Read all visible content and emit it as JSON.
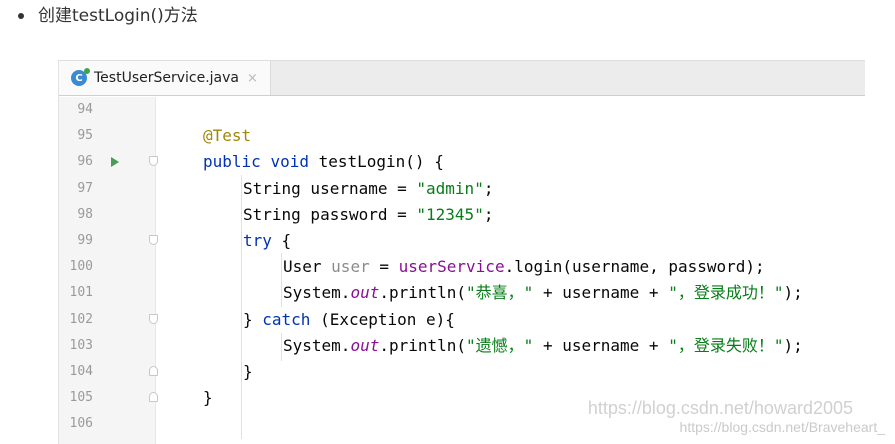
{
  "bullet": {
    "text": "创建testLogin()方法"
  },
  "tab": {
    "icon": "java-class-icon",
    "icon_letter": "C",
    "title": "TestUserService.java",
    "close": "×"
  },
  "lines": [
    {
      "n": "94"
    },
    {
      "n": "95"
    },
    {
      "n": "96"
    },
    {
      "n": "97"
    },
    {
      "n": "98"
    },
    {
      "n": "99"
    },
    {
      "n": "100"
    },
    {
      "n": "101"
    },
    {
      "n": "102"
    },
    {
      "n": "103"
    },
    {
      "n": "104"
    },
    {
      "n": "105"
    },
    {
      "n": "106"
    }
  ],
  "code": {
    "l95": {
      "annotation": "@Test"
    },
    "l96": {
      "kw1": "public",
      "kw2": "void",
      "rest": " testLogin() {"
    },
    "l97": {
      "pre": "String username = ",
      "str": "\"admin\"",
      "post": ";"
    },
    "l98": {
      "pre": "String password = ",
      "str": "\"12345\"",
      "post": ";"
    },
    "l99": {
      "kw": "try",
      "post": " {"
    },
    "l100": {
      "pre": "User ",
      "var": "user",
      "mid": " = ",
      "svc": "userService",
      "post": ".login(username, password);"
    },
    "l101": {
      "pre": "System.",
      "fld": "out",
      "mid": ".println(",
      "str1": "\"恭喜，\"",
      "op1": " + username + ",
      "str2": "\"，登录成功！\"",
      "post": ");"
    },
    "l102": {
      "pre": "} ",
      "kw": "catch",
      "post": " (Exception e){"
    },
    "l103": {
      "pre": "System.",
      "fld": "out",
      "mid": ".println(",
      "str1": "\"遗憾，\"",
      "op1": " + username + ",
      "str2": "\"，登录失败！\"",
      "post": ");"
    },
    "l104": {
      "text": "}"
    },
    "l105": {
      "text": "}"
    }
  },
  "watermark": {
    "line1": "https://blog.csdn.net/howard2005",
    "line2": "https://blog.csdn.net/Braveheart_"
  }
}
